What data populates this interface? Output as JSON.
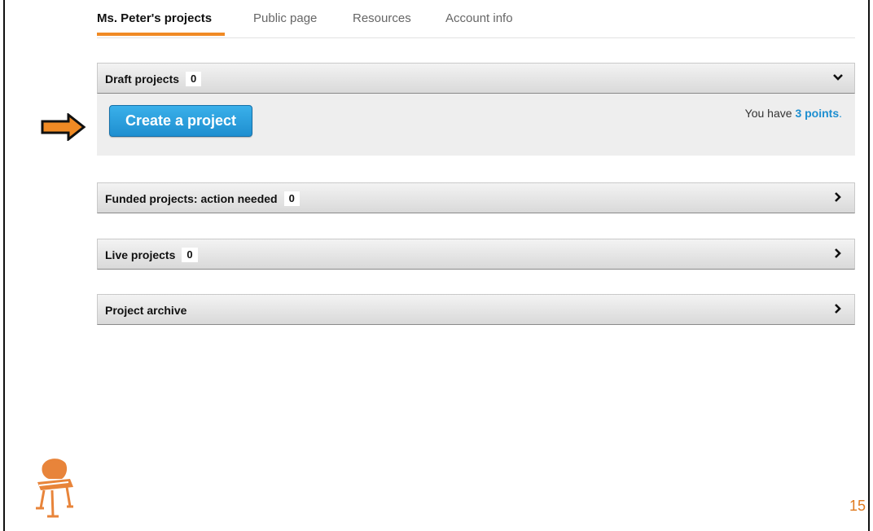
{
  "tabs": [
    {
      "label": "Ms. Peter's projects",
      "active": true
    },
    {
      "label": "Public page",
      "active": false
    },
    {
      "label": "Resources",
      "active": false
    },
    {
      "label": "Account info",
      "active": false
    }
  ],
  "sections": {
    "draft": {
      "title": "Draft projects",
      "count": "0",
      "expanded": true
    },
    "funded": {
      "title": "Funded projects: action needed",
      "count": "0",
      "expanded": false
    },
    "live": {
      "title": "Live projects",
      "count": "0",
      "expanded": false
    },
    "archive": {
      "title": "Project archive",
      "expanded": false
    }
  },
  "draft_body": {
    "create_button": "Create a project",
    "points_prefix": "You have ",
    "points_value": "3 points",
    "points_suffix": "."
  },
  "page_number": "15",
  "icons": {
    "annotation_arrow": "right-arrow-icon",
    "expanded_chevron": "chevron-down-icon",
    "collapsed_chevron": "chevron-right-icon",
    "logo": "chair-logo-icon"
  },
  "colors": {
    "accent_orange": "#f08a24",
    "button_blue": "#1f8fd0",
    "link_blue": "#1c8ed0",
    "page_number": "#e07a1f"
  }
}
